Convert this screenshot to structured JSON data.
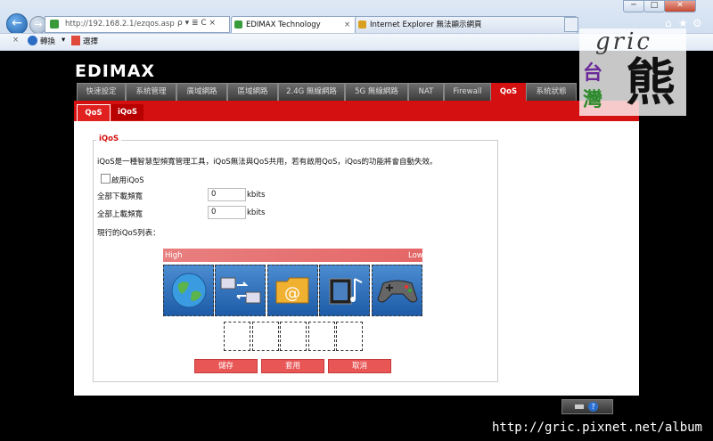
{
  "browser": {
    "address": "http://192.168.2.1/ezqos.asp",
    "address_controls": "ρ ▾ ≣ C ×",
    "tabs": [
      {
        "label": "EDIMAX Technology",
        "close": "×"
      },
      {
        "label": "Internet Explorer 無法顯示網頁"
      }
    ],
    "window_buttons": {
      "minimize": "─",
      "maximize": "□",
      "close": "✕"
    },
    "toolbar": {
      "close_glyph": "×",
      "convert_label": "轉換",
      "select_label": "選擇"
    },
    "colors": {
      "frame": "#c9d9ee",
      "accent": "#1f5fa8"
    }
  },
  "router": {
    "logo": "EDIMAX",
    "main_tabs": [
      "快速設定",
      "系統管理",
      "廣域網路",
      "區域網路",
      "2.4G 無線網路",
      "5G 無線網路",
      "NAT",
      "Firewall",
      "QoS",
      "系統狀態"
    ],
    "active_main_tab": "QoS",
    "sub_tabs": [
      "QoS",
      "iQoS"
    ],
    "active_sub_tab": "QoS",
    "section_title": "iQoS",
    "description": "iQoS是一種智慧型頻寬管理工具，iQoS無法與QoS共用，若有啟用QoS，iQos的功能將會自動失效。",
    "enable_label": "啟用iQoS",
    "download_label": "全部下載頻寬",
    "download_value": "0",
    "upload_label": "全部上載頻寬",
    "upload_value": "0",
    "unit": "kbits",
    "list_label": "現行的iQoS列表：",
    "priority_high": "High",
    "priority_low": "Low",
    "category_icons": [
      "globe-icon",
      "network-transfer-icon",
      "email-icon",
      "media-icon",
      "gamepad-icon"
    ],
    "buttons": {
      "save": "儲存",
      "apply": "套用",
      "cancel": "取消"
    },
    "colors": {
      "accent": "#d41010",
      "button": "#e85656",
      "tile": "#2d6fbd"
    }
  },
  "watermark": {
    "latin": "gric",
    "chinese_a": "台",
    "chinese_b": "灣",
    "chinese_c": "熊"
  },
  "footer_url": "http://gric.pixnet.net/album"
}
